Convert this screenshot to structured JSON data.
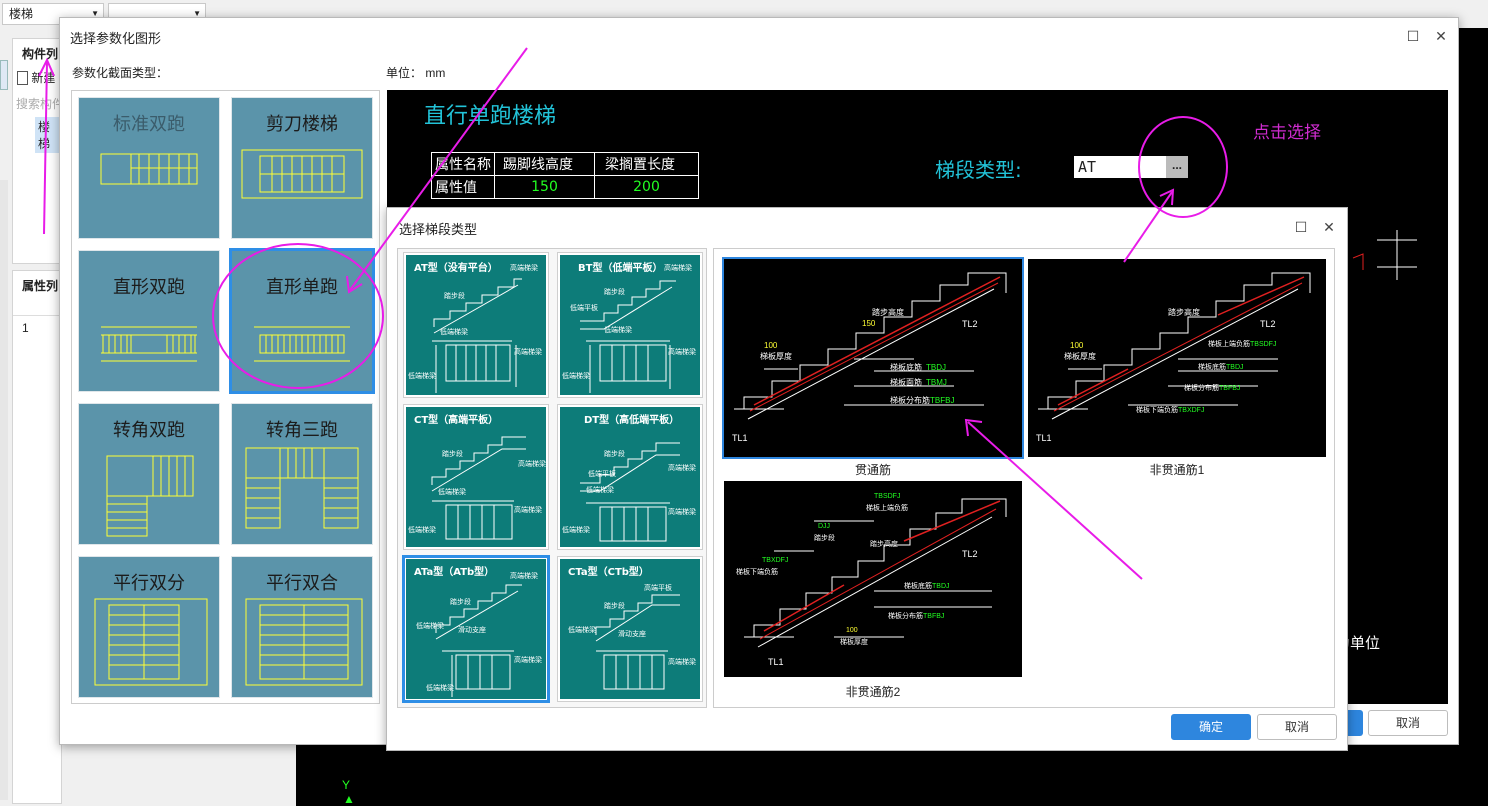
{
  "top": {
    "combo1": "楼梯",
    "combo2": ""
  },
  "left_panel": {
    "component_list_title": "构件列",
    "new_label": "新建",
    "search_placeholder": "搜索构件",
    "item": "楼梯",
    "property_title": "属性列",
    "row_no": "1"
  },
  "param_dialog": {
    "title": "选择参数化图形",
    "section_type_label": "参数化截面类型：",
    "unit_label": "单位：",
    "unit_value": "mm",
    "shapes": [
      "标准双跑",
      "剪刀楼梯",
      "直形双跑",
      "直形单跑",
      "转角双跑",
      "转角三跑",
      "平行双分",
      "平行双合"
    ],
    "selected_shape": "直形单跑",
    "drawing_title": "直行单跑楼梯",
    "click_hint": "点击选择",
    "segment_type_label": "梯段类型:",
    "segment_type_value": "AT",
    "ellipsis": "...",
    "table": {
      "headers": [
        "属性名称",
        "踢脚线高度",
        "梁搁置长度"
      ],
      "row_label": "属性值",
      "values": [
        "150",
        "200"
      ]
    },
    "unit_note": "为单位",
    "cancel": "取消"
  },
  "segment_dialog": {
    "title": "选择梯段类型",
    "types": [
      {
        "name": "AT型（没有平台）"
      },
      {
        "name": "BT型（低端平板）"
      },
      {
        "name": "CT型（高端平板）"
      },
      {
        "name": "DT型（高低端平板）"
      },
      {
        "name": "ATa型（ATb型）"
      },
      {
        "name": "CTa型（CTb型）"
      }
    ],
    "selected_type": "ATa型（ATb型）",
    "tile_labels": {
      "upper_beam": "高端梯梁",
      "lower_beam": "低端梯梁",
      "step": "踏步段",
      "high_plate": "高端平板",
      "low_plate": "低端平板",
      "slide": "滑动支座"
    },
    "rebar_options": [
      {
        "caption": "贯通筋"
      },
      {
        "caption": "非贯通筋1"
      },
      {
        "caption": "非贯通筋2"
      }
    ],
    "cad_labels": {
      "tl1": "TL1",
      "tl2": "TL2",
      "step_height": "踏步高度",
      "slab_thickness": "梯板厚度",
      "bottom_bar": "梯板底筋",
      "top_bar": "梯板面筋",
      "dist_bar": "梯板分布筋",
      "upper_bar": "梯板上端负筋",
      "lower_bar": "梯板下端负筋",
      "step_seg": "踏步段",
      "code_tbdj": "TBDJ",
      "code_tbmj": "TBMJ",
      "code_tbfbj": "TBFBJ",
      "code_tbsdfj": "TBSDFJ",
      "code_tbxdfj": "TBXDFJ",
      "code_djj": "DJJ",
      "val_100": "100",
      "val_150": "150"
    },
    "ok": "确定",
    "cancel": "取消"
  },
  "axis_label": "Y",
  "colors": {
    "accent_blue": "#2e86de",
    "annotation_magenta": "#e81ce8",
    "tile_teal": "#0d7c79",
    "shape_tile": "#5b94aa",
    "cad_yellow": "#ffff33",
    "cad_cyan": "#22c3d8"
  }
}
